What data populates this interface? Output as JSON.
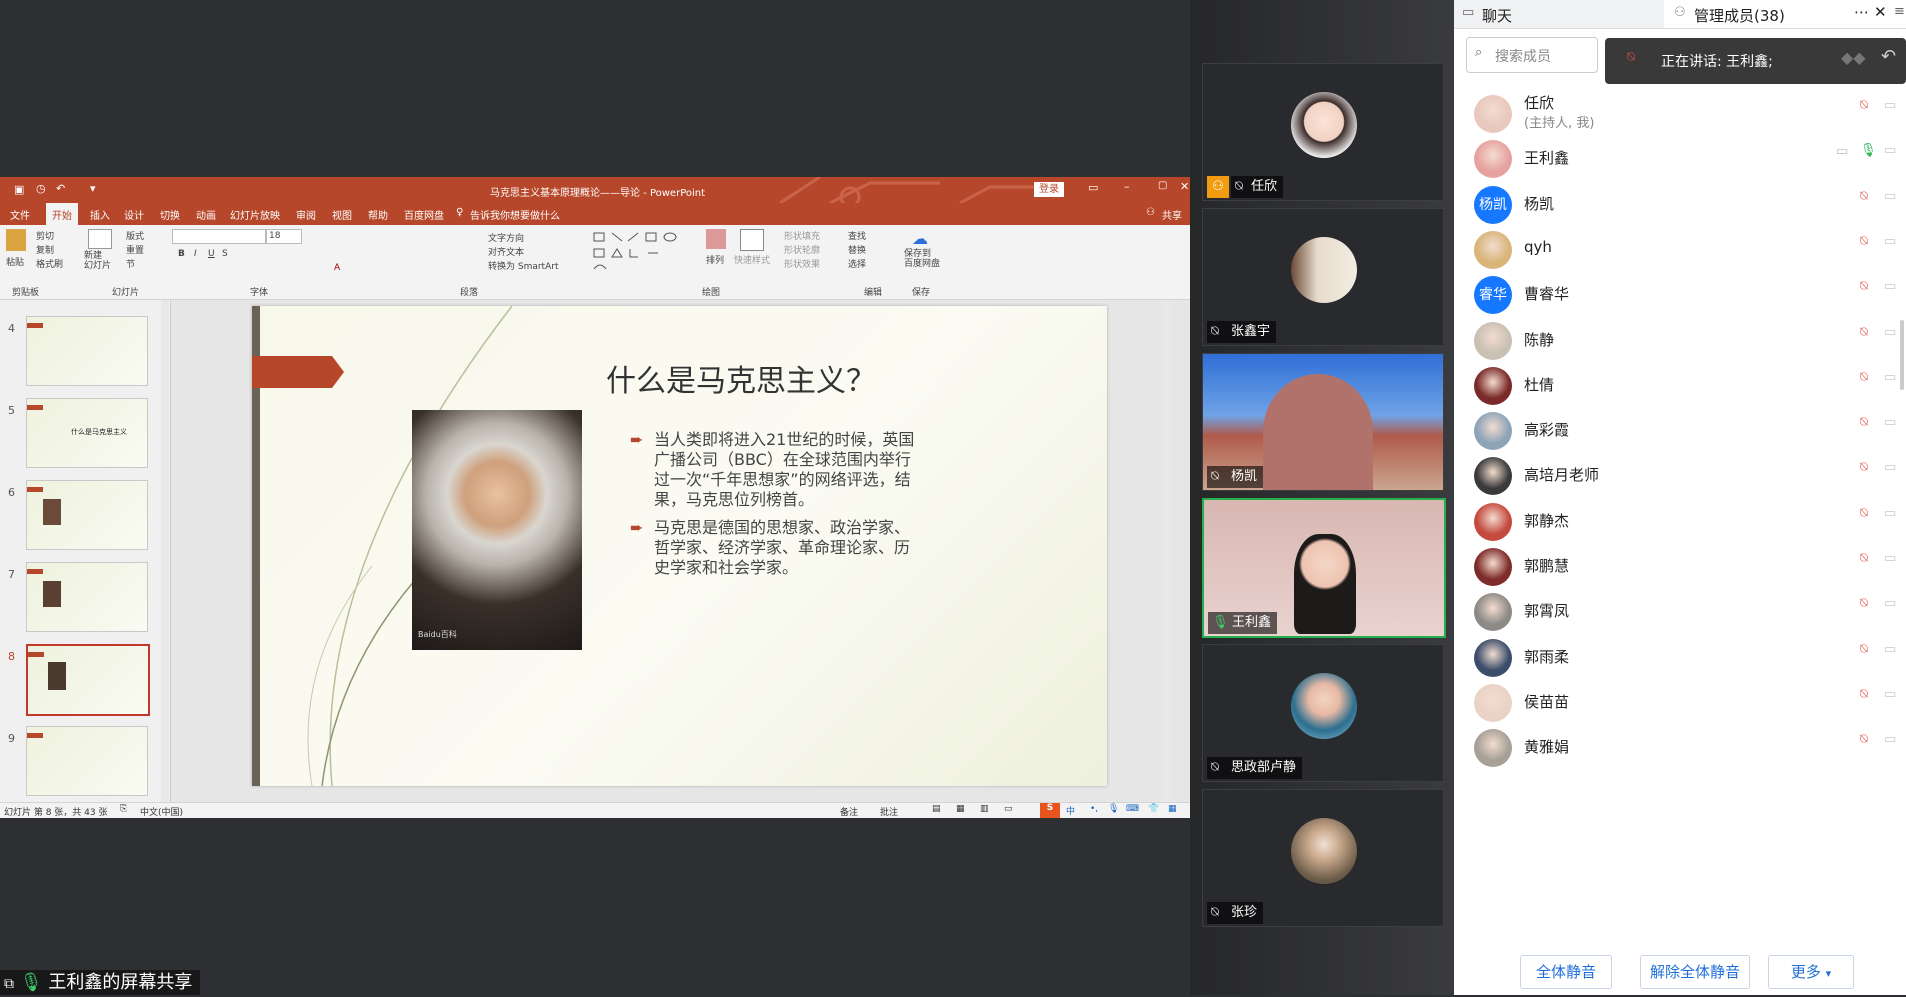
{
  "presentation": {
    "window_title": "马克思主义基本原理概论——导论 - PowerPoint",
    "login_button": "登录",
    "share_button": "共享",
    "tell_me": "告诉我你想要做什么",
    "tabs": [
      "文件",
      "开始",
      "插入",
      "设计",
      "切换",
      "动画",
      "幻灯片放映",
      "审阅",
      "视图",
      "帮助",
      "百度网盘"
    ],
    "ribbon_groups": [
      "剪贴板",
      "幻灯片",
      "字体",
      "段落",
      "绘图",
      "编辑",
      "保存"
    ],
    "ribbon_items": {
      "paste": "粘贴",
      "cut": "剪切",
      "copy": "复制",
      "format_painter": "格式刷",
      "new_slide": "新建\n幻灯片",
      "layout": "版式",
      "reset": "重置",
      "section": "节",
      "font_size": "18",
      "text_direction": "文字方向",
      "align_text": "对齐文本",
      "smartart": "转换为 SmartArt",
      "arrange": "排列",
      "quick_styles": "快速样式",
      "shape_fill": "形状填充",
      "shape_outline": "形状轮廓",
      "shape_effects": "形状效果",
      "find": "查找",
      "replace": "替换",
      "select": "选择",
      "save_baidu": "保存到\n百度网盘"
    },
    "thumbnails": [
      {
        "num": "4"
      },
      {
        "num": "5",
        "text": "什么是马克思主义"
      },
      {
        "num": "6"
      },
      {
        "num": "7"
      },
      {
        "num": "8",
        "selected": true
      },
      {
        "num": "9"
      }
    ],
    "slide": {
      "title": "什么是马克思主义？",
      "bullets": [
        "当人类即将进入21世纪的时候，英国广播公司（BBC）在全球范围内举行过一次“千年思想家”的网络评选，结果，马克思位列榜首。",
        "马克思是德国的思想家、政治学家、哲学家、经济学家、革命理论家、历史学家和社会学家。"
      ],
      "watermark": "Baidu百科"
    },
    "status": {
      "slide_counter": "幻灯片 第 8 张，共 43 张",
      "language": "中文(中国)",
      "notes": "备注",
      "comments": "批注"
    }
  },
  "share_label": "王利鑫的屏幕共享",
  "video_tiles": [
    {
      "name": "任欣",
      "mic": "muted",
      "host": true
    },
    {
      "name": "张鑫宇",
      "mic": "muted"
    },
    {
      "name": "杨凯",
      "mic": "muted"
    },
    {
      "name": "王利鑫",
      "mic": "on",
      "active": true
    },
    {
      "name": "思政部卢静",
      "mic": "muted"
    },
    {
      "name": "张珍",
      "mic": "muted"
    }
  ],
  "panel": {
    "tab_chat": "聊天",
    "tab_members": "管理成员(38)",
    "search_placeholder": "搜索成员",
    "speaking_toast": "正在讲话: 王利鑫;",
    "members": [
      {
        "name": "任欣",
        "sub": "(主持人, 我)",
        "avatar": "photo"
      },
      {
        "name": "王利鑫",
        "avatar": "photo",
        "mic": "on"
      },
      {
        "name": "杨凯",
        "avatar_text": "杨凯",
        "avatar_color": "#1677ff"
      },
      {
        "name": "qyh",
        "avatar": "photo"
      },
      {
        "name": "曹睿华",
        "avatar_text": "睿华",
        "avatar_color": "#1677ff"
      },
      {
        "name": "陈静",
        "avatar": "photo"
      },
      {
        "name": "杜倩",
        "avatar": "photo"
      },
      {
        "name": "高彩霞",
        "avatar": "photo"
      },
      {
        "name": "高培月老师",
        "avatar": "photo"
      },
      {
        "name": "郭静杰",
        "avatar": "photo"
      },
      {
        "name": "郭鹏慧",
        "avatar": "photo"
      },
      {
        "name": "郭霄凤",
        "avatar": "photo"
      },
      {
        "name": "郭雨柔",
        "avatar": "photo"
      },
      {
        "name": "侯苗苗",
        "avatar": "photo"
      },
      {
        "name": "黄雅娟",
        "avatar": "photo"
      }
    ],
    "buttons": {
      "mute_all": "全体静音",
      "unmute_all": "解除全体静音",
      "more": "更多"
    }
  },
  "colors": {
    "ppt_accent": "#b7472a",
    "meeting_blue": "#1677ff",
    "speaking_green": "#22b14c"
  }
}
